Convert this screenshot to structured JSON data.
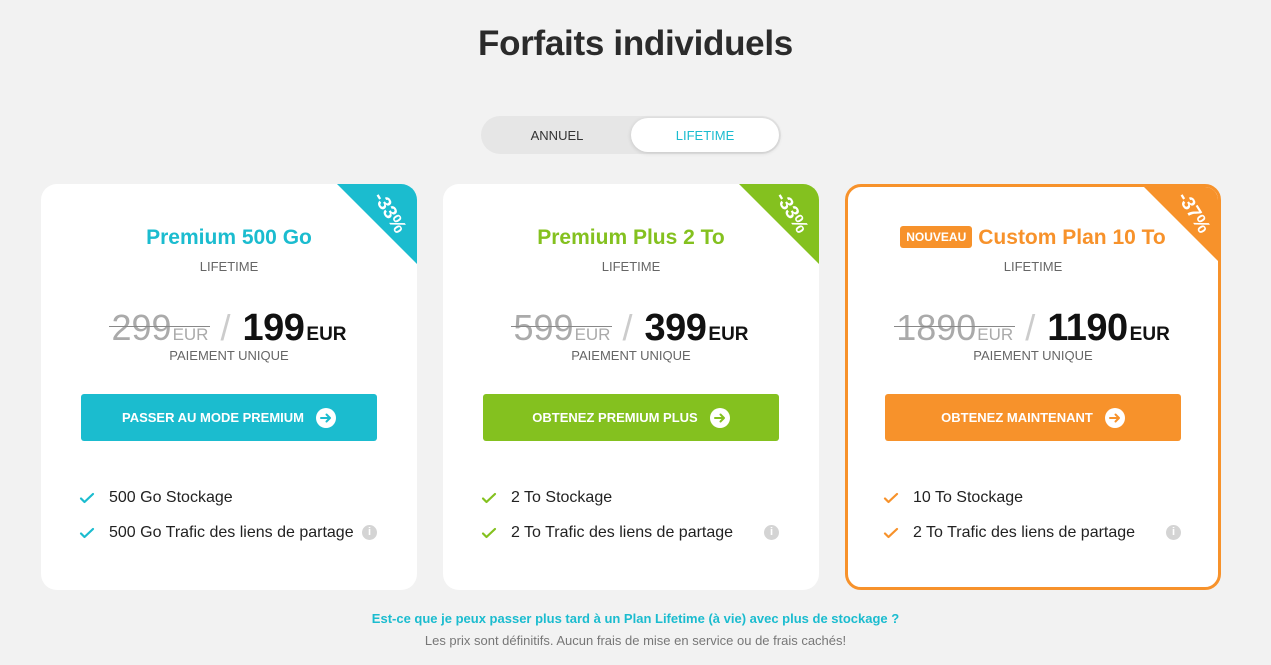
{
  "page_title": "Forfaits individuels",
  "toggle": {
    "annual": "ANNUEL",
    "lifetime": "LIFETIME",
    "selected": "lifetime"
  },
  "colors": {
    "teal": "#1bbccf",
    "green": "#84c11f",
    "orange": "#f7922b"
  },
  "plans": [
    {
      "badge": "",
      "title": "Premium 500 Go",
      "subtitle": "LIFETIME",
      "discount": "-33%",
      "old_price": "299",
      "old_currency": "EUR",
      "price": "199",
      "currency": "EUR",
      "price_note": "PAIEMENT UNIQUE",
      "cta": "PASSER AU MODE PREMIUM",
      "features": [
        "500 Go Stockage",
        "500 Go Trafic des liens de partage"
      ]
    },
    {
      "badge": "",
      "title": "Premium Plus 2 To",
      "subtitle": "LIFETIME",
      "discount": "-33%",
      "old_price": "599",
      "old_currency": "EUR",
      "price": "399",
      "currency": "EUR",
      "price_note": "PAIEMENT UNIQUE",
      "cta": "OBTENEZ PREMIUM PLUS",
      "features": [
        "2 To Stockage",
        "2 To Trafic des liens de partage"
      ]
    },
    {
      "badge": "NOUVEAU",
      "title": "Custom Plan 10 To",
      "subtitle": "LIFETIME",
      "discount": "-37%",
      "old_price": "1890",
      "old_currency": "EUR",
      "price": "1190",
      "currency": "EUR",
      "price_note": "PAIEMENT UNIQUE",
      "cta": "OBTENEZ MAINTENANT",
      "features": [
        "10 To Stockage",
        "2 To Trafic des liens de partage"
      ]
    }
  ],
  "faq": {
    "question": "Est-ce que je peux passer plus tard à un Plan Lifetime (à vie) avec plus de stockage ?",
    "answer": "Les prix sont définitifs. Aucun frais de mise en service ou de frais cachés!"
  }
}
